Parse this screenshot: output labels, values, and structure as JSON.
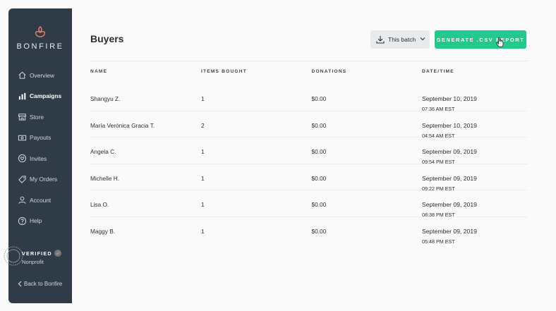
{
  "brand": {
    "name": "BONFIRE",
    "accent": "#e8866b"
  },
  "sidebar": {
    "items": [
      {
        "label": "Overview",
        "icon": "home-icon",
        "active": false
      },
      {
        "label": "Campaigns",
        "icon": "bar-chart-icon",
        "active": true
      },
      {
        "label": "Store",
        "icon": "store-icon",
        "active": false
      },
      {
        "label": "Payouts",
        "icon": "payout-icon",
        "active": false
      },
      {
        "label": "Invites",
        "icon": "heart-badge-icon",
        "active": false
      },
      {
        "label": "My Orders",
        "icon": "tag-icon",
        "active": false
      },
      {
        "label": "Account",
        "icon": "user-icon",
        "active": false
      },
      {
        "label": "Help",
        "icon": "help-icon",
        "active": false
      }
    ],
    "verified": {
      "title": "VERIFIED",
      "subtitle": "Nonprofit"
    },
    "back_label": "Back to Bonfire"
  },
  "header": {
    "title": "Buyers",
    "batch_select": "This batch",
    "csv_button": "GENERATE .CSV REPORT",
    "button_color": "#22c98b"
  },
  "table": {
    "columns": [
      "NAME",
      "ITEMS BOUGHT",
      "DONATIONS",
      "DATE/TIME"
    ],
    "rows": [
      {
        "name": "Shangyu Z.",
        "items": "1",
        "donation": "$0.00",
        "date": "September 10, 2019",
        "time": "07:36 AM EST"
      },
      {
        "name": "María Verónica Gracia T.",
        "items": "2",
        "donation": "$0.00",
        "date": "September 10, 2019",
        "time": "04:54 AM EST"
      },
      {
        "name": "Angela C.",
        "items": "1",
        "donation": "$0.00",
        "date": "September 09, 2019",
        "time": "09:54 PM EST"
      },
      {
        "name": "Michelle H.",
        "items": "1",
        "donation": "$0.00",
        "date": "September 09, 2019",
        "time": "09:22 PM EST"
      },
      {
        "name": "Lisa O.",
        "items": "1",
        "donation": "$0.00",
        "date": "September 09, 2019",
        "time": "08:38 PM EST"
      },
      {
        "name": "Maggy B.",
        "items": "1",
        "donation": "$0.00",
        "date": "September 09, 2019",
        "time": "05:48 PM EST"
      }
    ]
  }
}
